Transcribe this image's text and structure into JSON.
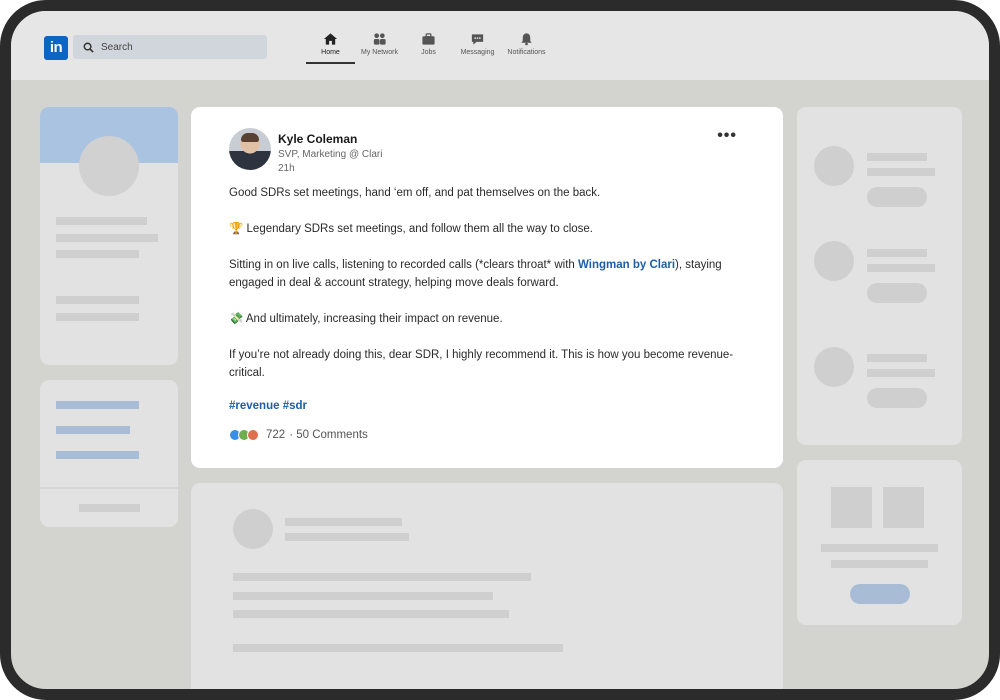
{
  "nav": {
    "search_placeholder": "Search",
    "items": [
      {
        "label": "Home",
        "icon": "home-icon"
      },
      {
        "label": "My Network",
        "icon": "network-icon"
      },
      {
        "label": "Jobs",
        "icon": "briefcase-icon"
      },
      {
        "label": "Messaging",
        "icon": "chat-icon"
      },
      {
        "label": "Notifications",
        "icon": "bell-icon"
      }
    ]
  },
  "post": {
    "author": "Kyle Coleman",
    "title": "SVP, Marketing @ Clari",
    "time": "21h",
    "more": "•••",
    "line1": "Good SDRs set meetings, hand ‘em off, and pat themselves on the back.",
    "line2_icon": "🏆",
    "line2": "Legendary SDRs set meetings, and follow them all the way to close.",
    "line3_before": "Sitting in on live calls, listening to recorded calls (*clears throat* with ",
    "line3_link": "Wingman by Clari",
    "line3_after": "), staying engaged in deal & account strategy, helping move deals forward.",
    "line4_icon": "💸",
    "line4": "And ultimately, increasing their impact on revenue.",
    "line5": "If you’re not already doing this, dear SDR, I highly recommend it. This is how you become revenue-critical.",
    "hashtags": "#revenue #sdr",
    "reactions_count": "722",
    "comments": "· 50 Comments"
  },
  "colors": {
    "brand": "#0a66c2",
    "link": "#1d5ea8",
    "frame": "#2b2b2b"
  }
}
